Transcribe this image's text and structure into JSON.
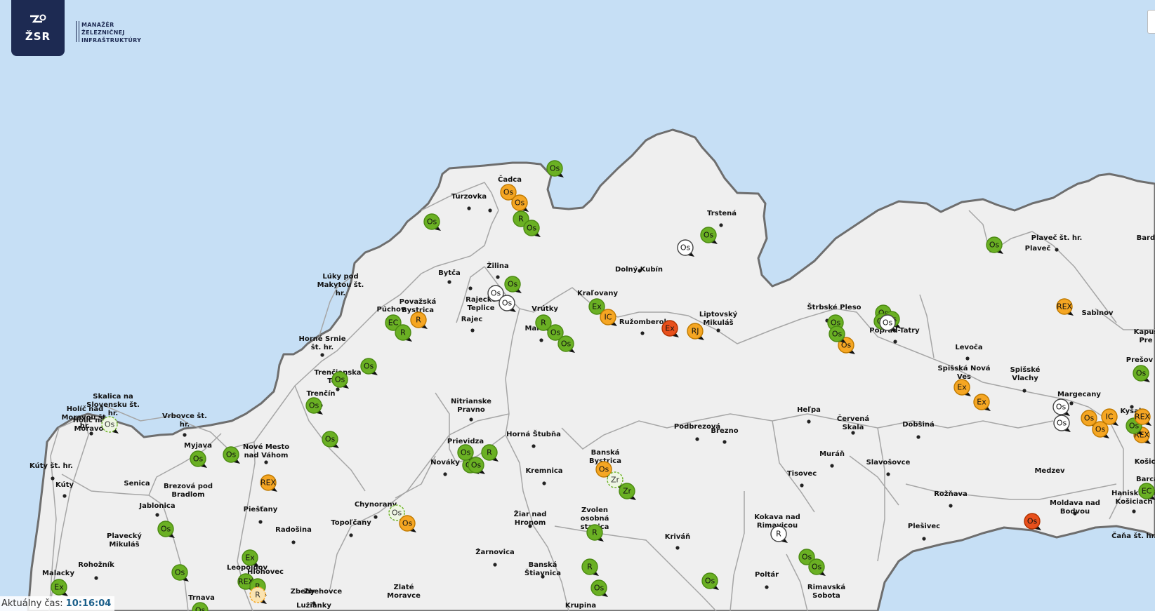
{
  "brand": {
    "logo_text": "ŽSR",
    "name_lines": [
      "MANAŽÉR",
      "ŽELEZNIČNEJ",
      "INFRAŠTRUKTÚRY"
    ]
  },
  "clock": {
    "label": "Aktuálny čas:",
    "time": "10:16:04"
  },
  "colors": {
    "sea": "#c6dff5",
    "land": "#efefef",
    "border": "#6e6e6e",
    "rail": "#a6a6a6",
    "green": "#6ab023",
    "orange": "#f5a623",
    "red": "#e8501c",
    "white": "#ffffff"
  },
  "icons": [
    "zsr-logo-icon",
    "train-marker-icon",
    "station-dot-icon"
  ],
  "cities": [
    {
      "id": "cadca",
      "lines": [
        "Čadca"
      ]
    },
    {
      "id": "turzovka",
      "lines": [
        "Turzovka"
      ]
    },
    {
      "id": "trstena",
      "lines": [
        "Trstená"
      ]
    },
    {
      "id": "zilina",
      "lines": [
        "Žilina"
      ]
    },
    {
      "id": "bytca",
      "lines": [
        "Bytča"
      ]
    },
    {
      "id": "dolny-kubin",
      "lines": [
        "Dolný Kubín"
      ]
    },
    {
      "id": "luky",
      "lines": [
        "Lúky pod",
        "Makytou št.",
        "hr."
      ]
    },
    {
      "id": "povazska",
      "lines": [
        "Považská",
        "Bystrica"
      ]
    },
    {
      "id": "puchov",
      "lines": [
        "Púchov"
      ]
    },
    {
      "id": "rajecke",
      "lines": [
        "Rajecké",
        "Teplice"
      ]
    },
    {
      "id": "rajec",
      "lines": [
        "Rajec"
      ]
    },
    {
      "id": "vrutky",
      "lines": [
        "Vrútky"
      ]
    },
    {
      "id": "martin",
      "lines": [
        "Martin"
      ]
    },
    {
      "id": "kralovany",
      "lines": [
        "Kraľovany"
      ]
    },
    {
      "id": "ruzomberok",
      "lines": [
        "Ružomberok"
      ]
    },
    {
      "id": "liptovsky",
      "lines": [
        "Liptovský",
        "Mikuláš"
      ]
    },
    {
      "id": "strbske",
      "lines": [
        "Štrbské Pleso"
      ]
    },
    {
      "id": "poprad",
      "lines": [
        "Poprad-Tatry"
      ]
    },
    {
      "id": "plavec-sthr",
      "lines": [
        "Plaveč št. hr."
      ]
    },
    {
      "id": "plavec",
      "lines": [
        "Plaveč"
      ]
    },
    {
      "id": "bardejov",
      "lines": [
        "Bardej"
      ]
    },
    {
      "id": "sabinov",
      "lines": [
        "Sabinov"
      ]
    },
    {
      "id": "kapusany",
      "lines": [
        "Kapuš",
        "Pre"
      ]
    },
    {
      "id": "levoca",
      "lines": [
        "Levoča"
      ]
    },
    {
      "id": "presov",
      "lines": [
        "Prešov"
      ]
    },
    {
      "id": "spisska-nova",
      "lines": [
        "Spišská Nová",
        "Ves"
      ]
    },
    {
      "id": "spisske-vlachy",
      "lines": [
        "Spišské",
        "Vlachy"
      ]
    },
    {
      "id": "margecany",
      "lines": [
        "Margecany"
      ]
    },
    {
      "id": "kysak",
      "lines": [
        "Kysak"
      ]
    },
    {
      "id": "horne-srnie",
      "lines": [
        "Horné Srnie",
        "št. hr."
      ]
    },
    {
      "id": "trencianska",
      "lines": [
        "Trenčianska",
        "Teplá"
      ]
    },
    {
      "id": "trencin",
      "lines": [
        "Trenčín"
      ]
    },
    {
      "id": "skalica",
      "lines": [
        "Skalica na",
        "Slovensku št.",
        "hr."
      ]
    },
    {
      "id": "holic-nad",
      "lines": [
        "Holíč nad",
        "Moravou št.",
        "hr."
      ]
    },
    {
      "id": "holic",
      "lines": [
        "Holíč nad",
        "Moravou"
      ]
    },
    {
      "id": "vrbovce",
      "lines": [
        "Vrbovce št.",
        "hr."
      ]
    },
    {
      "id": "kuty-sthr",
      "lines": [
        "Kúty št. hr."
      ]
    },
    {
      "id": "kuty",
      "lines": [
        "Kúty"
      ]
    },
    {
      "id": "myjava",
      "lines": [
        "Myjava"
      ]
    },
    {
      "id": "nove-mesto",
      "lines": [
        "Nové Mesto",
        "nad Váhom"
      ]
    },
    {
      "id": "senica",
      "lines": [
        "Senica"
      ]
    },
    {
      "id": "brezova",
      "lines": [
        "Brezová pod",
        "Bradlom"
      ]
    },
    {
      "id": "jablonica",
      "lines": [
        "Jablonica"
      ]
    },
    {
      "id": "piestany",
      "lines": [
        "Piešťany"
      ]
    },
    {
      "id": "plavecky",
      "lines": [
        "Plavecký",
        "Mikuláš"
      ]
    },
    {
      "id": "radosina",
      "lines": [
        "Radošina"
      ]
    },
    {
      "id": "rohoznik",
      "lines": [
        "Rohožník"
      ]
    },
    {
      "id": "malacky",
      "lines": [
        "Malacky"
      ]
    },
    {
      "id": "leopoldov",
      "lines": [
        "Leopoldov"
      ]
    },
    {
      "id": "hlohovec",
      "lines": [
        "Hlohovec"
      ]
    },
    {
      "id": "trnava",
      "lines": [
        "Trnava"
      ]
    },
    {
      "id": "zbehy",
      "lines": [
        "Zbehy"
      ]
    },
    {
      "id": "zbehovce",
      "lines": [
        "Zbehovce"
      ]
    },
    {
      "id": "luzianky",
      "lines": [
        "Lužianky"
      ]
    },
    {
      "id": "zlate",
      "lines": [
        "Zlaté",
        "Moravce"
      ]
    },
    {
      "id": "nitrianske",
      "lines": [
        "Nitrianske",
        "Pravno"
      ]
    },
    {
      "id": "prievidza",
      "lines": [
        "Prievidza"
      ]
    },
    {
      "id": "novaky",
      "lines": [
        "Nováky"
      ]
    },
    {
      "id": "chynorany",
      "lines": [
        "Chynorany"
      ]
    },
    {
      "id": "topolcany",
      "lines": [
        "Topoľčany"
      ]
    },
    {
      "id": "horna-stubna",
      "lines": [
        "Horná Štubňa"
      ]
    },
    {
      "id": "kremnica",
      "lines": [
        "Kremnica"
      ]
    },
    {
      "id": "ziar",
      "lines": [
        "Žiar nad",
        "Hronom"
      ]
    },
    {
      "id": "zarnovica",
      "lines": [
        "Žarnovica"
      ]
    },
    {
      "id": "banska-stiavnica",
      "lines": [
        "Banská",
        "Štiavnica"
      ]
    },
    {
      "id": "banska-bystrica",
      "lines": [
        "Banská",
        "Bystrica"
      ]
    },
    {
      "id": "zvolen",
      "lines": [
        "Zvolen",
        "osobná",
        "stanica"
      ]
    },
    {
      "id": "krupina",
      "lines": [
        "Krupina"
      ]
    },
    {
      "id": "krivan",
      "lines": [
        "Kriváň"
      ]
    },
    {
      "id": "podbrezova",
      "lines": [
        "Podbrezová"
      ]
    },
    {
      "id": "brezno",
      "lines": [
        "Brezno"
      ]
    },
    {
      "id": "helpa",
      "lines": [
        "Heľpa"
      ]
    },
    {
      "id": "cervena-skala",
      "lines": [
        "Červená",
        "Skala"
      ]
    },
    {
      "id": "dobsina",
      "lines": [
        "Dobšiná"
      ]
    },
    {
      "id": "muran",
      "lines": [
        "Muráň"
      ]
    },
    {
      "id": "slavosovce",
      "lines": [
        "Slavošovce"
      ]
    },
    {
      "id": "tisovec",
      "lines": [
        "Tisovec"
      ]
    },
    {
      "id": "roznava",
      "lines": [
        "Rožňava"
      ]
    },
    {
      "id": "plesivec",
      "lines": [
        "Plešivec"
      ]
    },
    {
      "id": "kokava",
      "lines": [
        "Kokava nad",
        "Rimavicou"
      ]
    },
    {
      "id": "poltar",
      "lines": [
        "Poltár"
      ]
    },
    {
      "id": "rimavska",
      "lines": [
        "Rimavská",
        "Sobota"
      ]
    },
    {
      "id": "medzev",
      "lines": [
        "Medzev"
      ]
    },
    {
      "id": "moldava",
      "lines": [
        "Moldava nad",
        "Bodvou"
      ]
    },
    {
      "id": "kosice",
      "lines": [
        "Košice"
      ]
    },
    {
      "id": "barca",
      "lines": [
        "Barca"
      ]
    },
    {
      "id": "hanisce",
      "lines": [
        "Haniska pri",
        "Košiciach"
      ]
    },
    {
      "id": "cana",
      "lines": [
        "Čaňa št. hr."
      ]
    }
  ],
  "trains": [
    {
      "label": "Os",
      "color": "green"
    },
    {
      "label": "Os",
      "color": "orange"
    },
    {
      "label": "Os",
      "color": "orange"
    },
    {
      "label": "R",
      "color": "green"
    },
    {
      "label": "Os",
      "color": "green"
    },
    {
      "label": "Os",
      "color": "green"
    },
    {
      "label": "Os",
      "color": "white"
    },
    {
      "label": "Os",
      "color": "white"
    },
    {
      "label": "Os",
      "color": "green"
    },
    {
      "label": "Os",
      "color": "white"
    },
    {
      "label": "Os",
      "color": "green"
    },
    {
      "label": "Ex",
      "color": "green"
    },
    {
      "label": "IC",
      "color": "orange"
    },
    {
      "label": "R",
      "color": "green"
    },
    {
      "label": "Os",
      "color": "green"
    },
    {
      "label": "Os",
      "color": "green"
    },
    {
      "label": "Ex",
      "color": "red"
    },
    {
      "label": "RJ",
      "color": "orange"
    },
    {
      "label": "Os",
      "color": "green"
    },
    {
      "label": "Os",
      "color": "green"
    },
    {
      "label": "Os",
      "color": "orange"
    },
    {
      "label": "Os",
      "color": "green"
    },
    {
      "label": "Os",
      "color": "green"
    },
    {
      "label": "Os",
      "color": "green"
    },
    {
      "label": "Os",
      "color": "white"
    },
    {
      "label": "Os",
      "color": "green"
    },
    {
      "label": "REX",
      "color": "orange"
    },
    {
      "label": "Ex",
      "color": "orange"
    },
    {
      "label": "Ex",
      "color": "orange"
    },
    {
      "label": "Os",
      "color": "green"
    },
    {
      "label": "Os",
      "color": "white"
    },
    {
      "label": "Os",
      "color": "white"
    },
    {
      "label": "Os",
      "color": "orange"
    },
    {
      "label": "Os",
      "color": "orange"
    },
    {
      "label": "IC",
      "color": "orange"
    },
    {
      "label": "REX",
      "color": "orange"
    },
    {
      "label": "Os",
      "color": "green"
    },
    {
      "label": "REX",
      "color": "orange"
    },
    {
      "label": "EC",
      "color": "green"
    },
    {
      "label": "Os",
      "color": "green"
    },
    {
      "label": "R",
      "color": "orange"
    },
    {
      "label": "EC",
      "color": "green"
    },
    {
      "label": "R",
      "color": "green"
    },
    {
      "label": "Os",
      "color": "green"
    },
    {
      "label": "Os",
      "color": "green"
    },
    {
      "label": "Os",
      "color": "green-light"
    },
    {
      "label": "Os",
      "color": "green"
    },
    {
      "label": "Os",
      "color": "green"
    },
    {
      "label": "Os",
      "color": "green"
    },
    {
      "label": "Os",
      "color": "green"
    },
    {
      "label": "REX",
      "color": "orange"
    },
    {
      "label": "Os",
      "color": "green"
    },
    {
      "label": "Os",
      "color": "green"
    },
    {
      "label": "Ex",
      "color": "green"
    },
    {
      "label": "REX",
      "color": "green"
    },
    {
      "label": "R",
      "color": "green"
    },
    {
      "label": "R",
      "color": "orange-light"
    },
    {
      "label": "Os",
      "color": "green"
    },
    {
      "label": "Ex",
      "color": "green"
    },
    {
      "label": "Os",
      "color": "green"
    },
    {
      "label": "R",
      "color": "green"
    },
    {
      "label": "Os",
      "color": "green"
    },
    {
      "label": "Os",
      "color": "green-light"
    },
    {
      "label": "Os",
      "color": "orange"
    },
    {
      "label": "Os",
      "color": "orange"
    },
    {
      "label": "Zr",
      "color": "green-light"
    },
    {
      "label": "Zr",
      "color": "green"
    },
    {
      "label": "R",
      "color": "green"
    },
    {
      "label": "R",
      "color": "green"
    },
    {
      "label": "Os",
      "color": "green"
    },
    {
      "label": "Os",
      "color": "green"
    },
    {
      "label": "R",
      "color": "white"
    },
    {
      "label": "Os",
      "color": "green"
    },
    {
      "label": "Os",
      "color": "green"
    },
    {
      "label": "Os",
      "color": "red"
    },
    {
      "label": "R",
      "color": "orange"
    }
  ]
}
